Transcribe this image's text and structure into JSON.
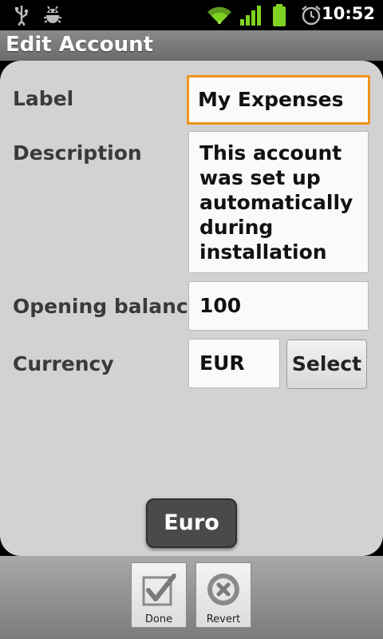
{
  "status_bar": {
    "time": "10:52",
    "icons": [
      "usb-icon",
      "android-debug-icon",
      "wifi-icon",
      "signal-icon",
      "battery-icon",
      "alarm-icon"
    ]
  },
  "header": {
    "title": "Edit Account"
  },
  "form": {
    "label_label": "Label",
    "label_value": "My Expenses",
    "description_label": "Description",
    "description_value": "This account was set up automatically during installation",
    "opening_balance_label": "Opening balance",
    "opening_balance_value": "100",
    "currency_label": "Currency",
    "currency_value": "EUR",
    "select_label": "Select"
  },
  "toast": {
    "text": "Euro"
  },
  "bottom_bar": {
    "done_label": "Done",
    "revert_label": "Revert"
  },
  "colors": {
    "focus": "#f0931a",
    "card": "#d2d2d2",
    "status_green": "#7ed321"
  }
}
